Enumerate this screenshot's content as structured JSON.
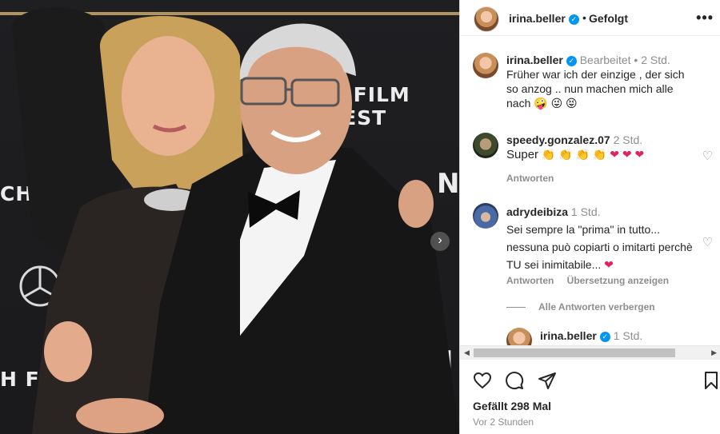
{
  "post": {
    "username": "irina.beller",
    "separator": "•",
    "follow_status": "Gefolgt",
    "likes_text": "Gefällt 298 Mal",
    "time_text": "Vor 2 Stunden"
  },
  "photo": {
    "backdrop_texts": [
      "H FILM FEST",
      "CH",
      "N",
      "H FIL",
      "N"
    ],
    "next_arrow": "›"
  },
  "comments": [
    {
      "username": "irina.beller",
      "verified": true,
      "meta": "Bearbeitet •  2 Std.",
      "text": "Früher war ich der einzige , der sich so anzog .. nun machen mich alle nach",
      "emoji": "🤪 😜 😝"
    },
    {
      "username": "speedy.gonzalez.07",
      "meta": "2 Std.",
      "text": "Super",
      "emoji_clap": "👏 👏 👏 👏",
      "emoji_hearts": "❤ ❤ ❤",
      "reply_label": "Antworten"
    },
    {
      "username": "adrydeibiza",
      "meta": "1 Std.",
      "text": "Sei sempre la \"prima\" in tutto... nessuna può copiarti o imitarti perchè TU sei inimitabile...",
      "emoji_heart": "❤",
      "reply_label": "Antworten",
      "translate_label": "Übersetzung anzeigen"
    }
  ],
  "hide_replies_label": "Alle Antworten verbergen",
  "reply": {
    "username": "irina.beller",
    "meta": "1 Std."
  },
  "icons": {
    "more": "•••",
    "heart": "heart-icon",
    "comment": "comment-icon",
    "share": "share-icon",
    "bookmark": "bookmark-icon"
  },
  "colors": {
    "verified": "#0095f6",
    "heart_red": "#e0245e",
    "text_grey": "#8e8e8e"
  }
}
